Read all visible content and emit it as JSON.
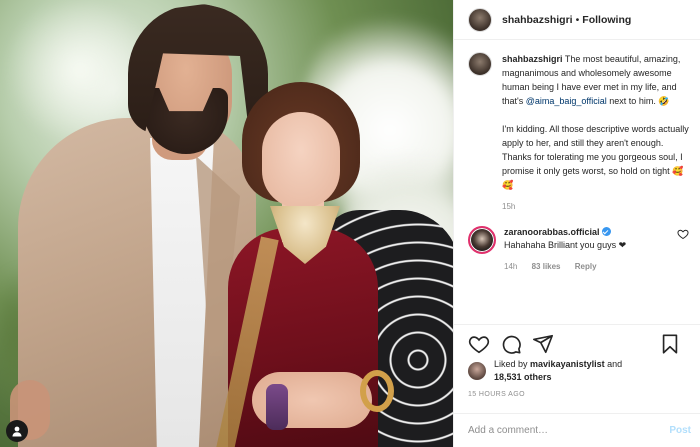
{
  "header": {
    "username": "shahbazshigri",
    "separator": "•",
    "follow_status": "Following"
  },
  "caption": {
    "username": "shahbazshigri",
    "text_before_mention": "The most beautiful, amazing, magnanimous and wholesomely awesome human being I have ever met in my life, and that's",
    "mention": "@aima_baig_official",
    "text_after_mention": "next to him. 🤣",
    "paragraph_2": "I'm kidding. All those descriptive words actually apply to her, and still they aren't enough. Thanks for tolerating me you gorgeous soul, I promise it only gets worst, so hold on tight 🥰🥰",
    "time": "15h"
  },
  "comment": {
    "username": "zaranoorabbas.official",
    "text": "Hahahaha Brilliant you guys ❤",
    "time": "14h",
    "likes": "83 likes",
    "reply": "Reply"
  },
  "likes": {
    "prefix": "Liked by",
    "user": "mavikayanistylist",
    "conjunction": "and",
    "others": "18,531 others"
  },
  "timestamp": "15 HOURS AGO",
  "add_comment": {
    "placeholder": "Add a comment…",
    "post_label": "Post"
  },
  "icons": {
    "like": "heart-icon",
    "comment": "comment-icon",
    "share": "paper-plane-icon",
    "save": "bookmark-icon"
  },
  "colors": {
    "link": "#00376b",
    "meta": "#8e8e8e",
    "verified": "#3897f0",
    "post_disabled": "#b2dffc"
  }
}
